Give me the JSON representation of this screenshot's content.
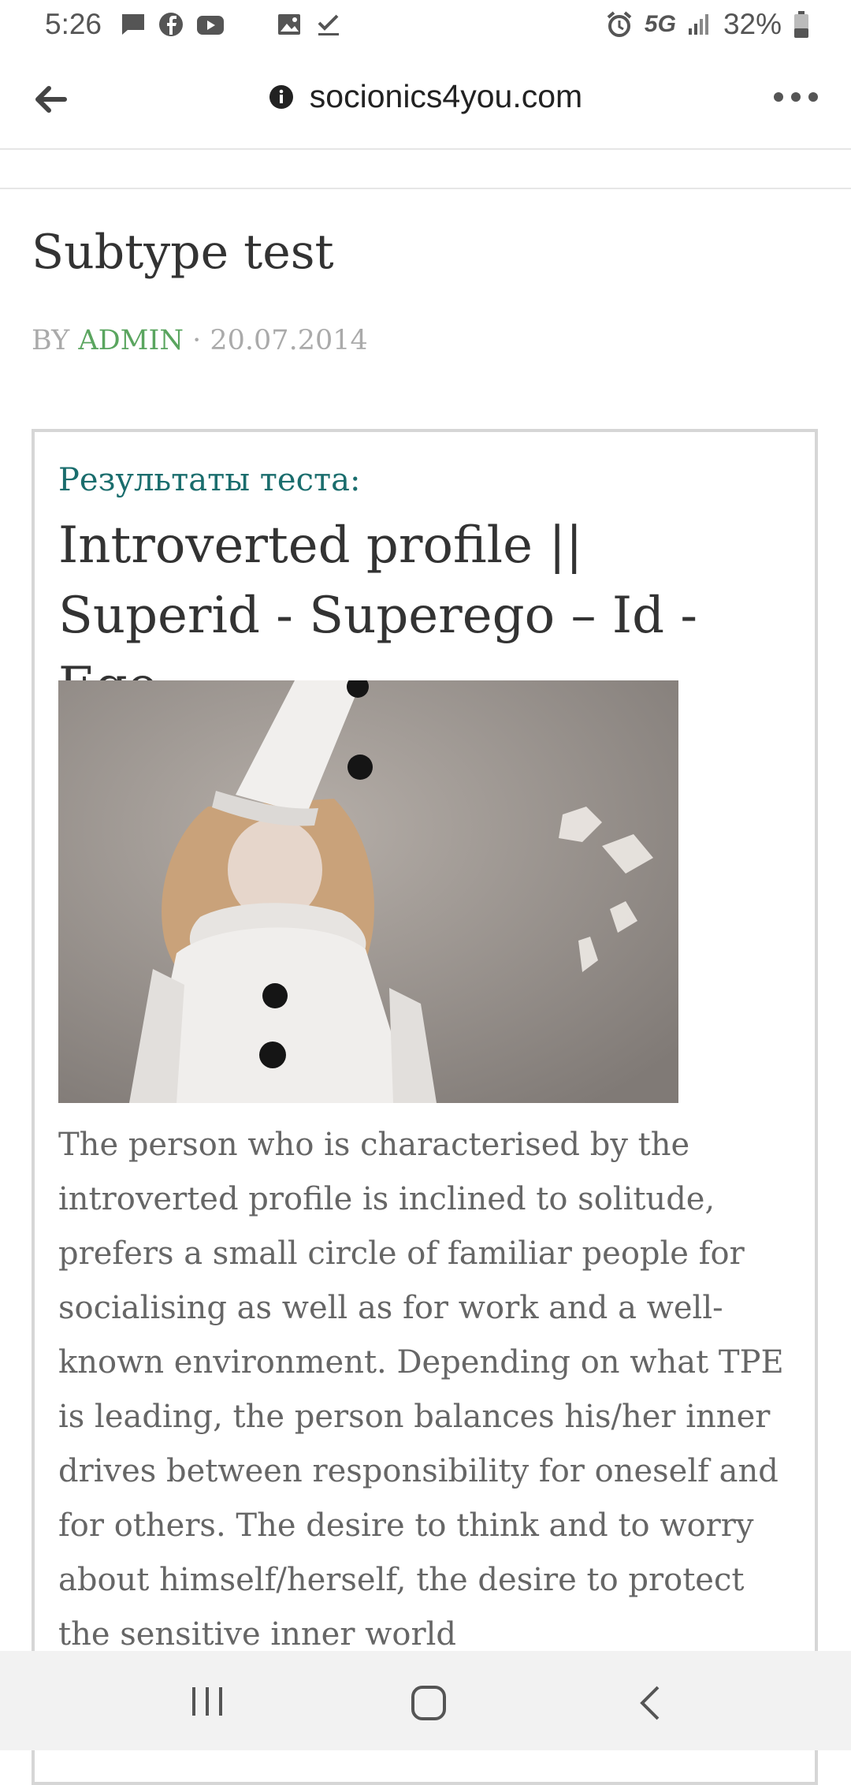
{
  "status_bar": {
    "time": "5:26",
    "battery": "32%",
    "network": "5G",
    "left_icons": [
      "message-icon",
      "facebook-icon",
      "youtube-icon",
      "image-icon",
      "check-icon"
    ],
    "right_icons": [
      "alarm-icon",
      "signal-icon",
      "battery-icon"
    ]
  },
  "browser": {
    "url": "socionics4you.com",
    "back_icon": "back-arrow-icon",
    "info_icon": "info-icon",
    "menu_icon": "more-icon"
  },
  "post": {
    "title": "Subtype test",
    "by": "BY ",
    "author": "ADMIN",
    "date_sep": " · ",
    "date": "20.07.2014"
  },
  "result": {
    "label": "Результаты теста:",
    "heading": "Introverted profile || Superid - Superego – Id - Ego",
    "photo_alt": "child in white pierrot costume",
    "text": "The person who is characterised by the introverted profile is inclined to solitude, prefers a small circle of familiar people for socialising as well as for work and a well-known environment. Depending on what TPE is leading, the person balances his/her inner drives between responsibility for oneself and for others. The desire to think and to worry about himself/herself, the desire to protect the sensitive inner world"
  },
  "nav_bar": {
    "buttons": [
      "recent-apps-icon",
      "home-icon",
      "back-icon"
    ]
  },
  "colors": {
    "author_link": "#5aa55f",
    "result_label": "#1a6d6d",
    "box_border": "#d6d6d6"
  }
}
